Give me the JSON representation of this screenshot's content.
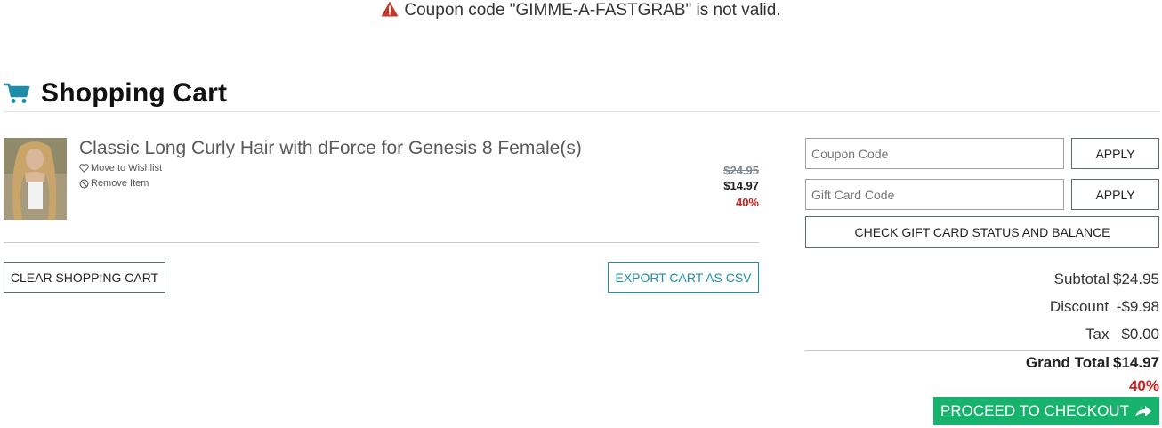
{
  "alert": {
    "message": "Coupon code \"GIMME-A-FASTGRAB\" is not valid.",
    "icon": "warning-icon",
    "icon_color": "#c0392b"
  },
  "cart": {
    "title": "Shopping Cart",
    "icon": "cart-icon",
    "icon_color": "#1d8ea5"
  },
  "item": {
    "title": "Classic Long Curly Hair with dForce for Genesis 8 Female(s)",
    "wishlist_label": "Move to Wishlist",
    "remove_label": "Remove Item",
    "price_original": "$24.95",
    "price_sale": "$14.97",
    "discount_pct": "40%"
  },
  "actions": {
    "clear_label": "CLEAR SHOPPING CART",
    "export_label": "EXPORT CART AS CSV"
  },
  "sidebar": {
    "coupon_placeholder": "Coupon Code",
    "coupon_apply": "APPLY",
    "gift_placeholder": "Gift Card Code",
    "gift_apply": "APPLY",
    "check_label": "CHECK GIFT CARD STATUS AND BALANCE"
  },
  "summary": {
    "subtotal_label": "Subtotal",
    "subtotal_value": "$24.95",
    "discount_label": "Discount",
    "discount_value": "-$9.98",
    "tax_label": "Tax",
    "tax_value": "$0.00",
    "grand_label": "Grand Total",
    "grand_value": "$14.97",
    "grand_pct": "40%"
  },
  "checkout": {
    "label": "PROCEED TO CHECKOUT",
    "color": "#17b26c"
  }
}
